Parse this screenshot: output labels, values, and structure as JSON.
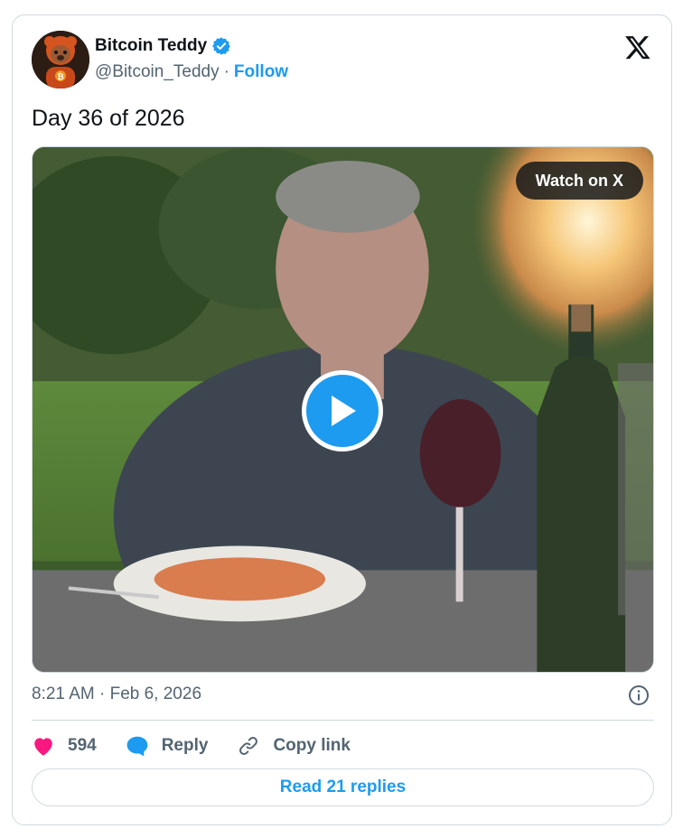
{
  "author": {
    "display_name": "Bitcoin Teddy",
    "handle": "@Bitcoin_Teddy",
    "separator": "·",
    "follow_label": "Follow",
    "verified": true
  },
  "tweet": {
    "text": "Day 36 of 2026",
    "timestamp": "8:21 AM · Feb 6, 2026"
  },
  "media": {
    "watch_label": "Watch on X"
  },
  "actions": {
    "like_count": "594",
    "reply_label": "Reply",
    "copy_label": "Copy link"
  },
  "footer": {
    "read_replies_label": "Read 21 replies"
  },
  "icons": {
    "like": "heart-icon",
    "reply": "speech-bubble-icon",
    "copy": "link-icon",
    "info": "info-icon",
    "brand": "x-logo-icon",
    "play": "play-icon"
  },
  "colors": {
    "accent": "#1d9bf0",
    "like": "#f91880",
    "text_primary": "#0f1419",
    "text_secondary": "#536471",
    "border": "#cfd9de"
  }
}
